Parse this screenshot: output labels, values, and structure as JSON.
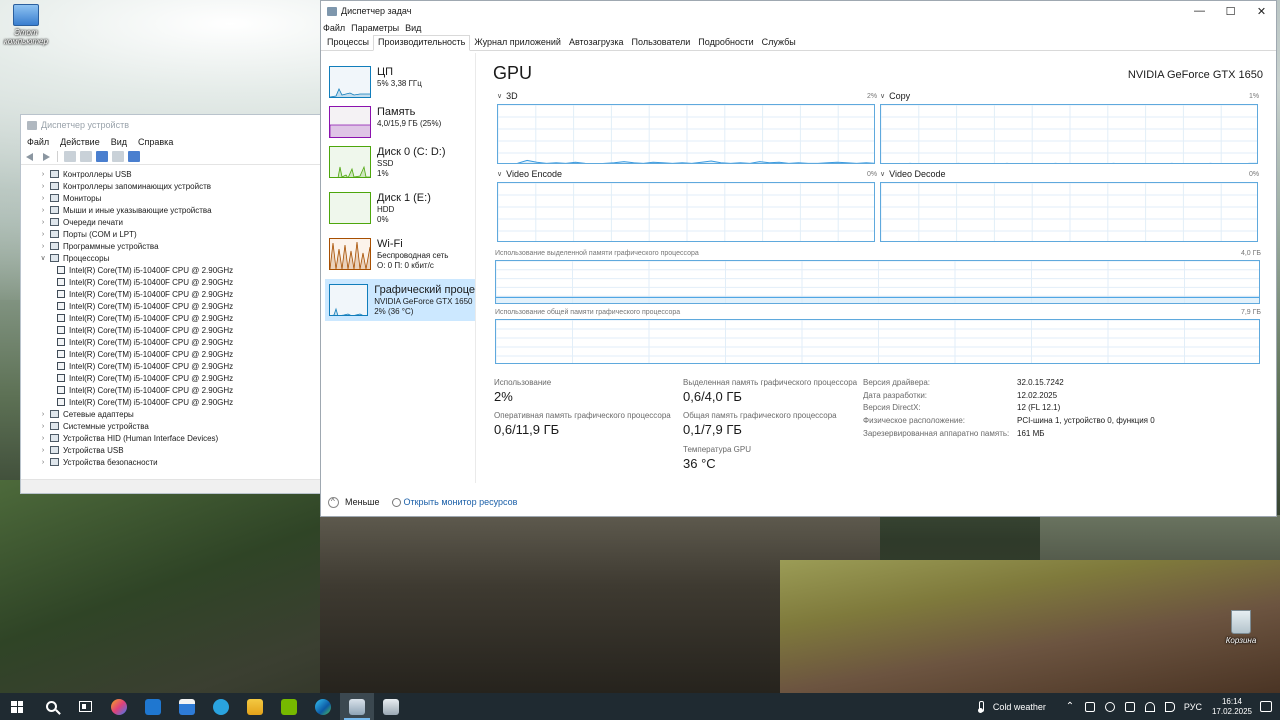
{
  "desktop": {
    "this_pc_label": "Этот компьютер",
    "recycle_bin_label": "Корзина"
  },
  "device_manager": {
    "title": "Диспетчер устройств",
    "menu": [
      "Файл",
      "Действие",
      "Вид",
      "Справка"
    ],
    "tree": [
      {
        "label": "Контроллеры USB",
        "expanded": false
      },
      {
        "label": "Контроллеры запоминающих устройств",
        "expanded": false
      },
      {
        "label": "Мониторы",
        "expanded": false
      },
      {
        "label": "Мыши и иные указывающие устройства",
        "expanded": false
      },
      {
        "label": "Очереди печати",
        "expanded": false
      },
      {
        "label": "Порты (COM и LPT)",
        "expanded": false
      },
      {
        "label": "Программные устройства",
        "expanded": false
      },
      {
        "label": "Процессоры",
        "expanded": true
      },
      {
        "label": "Сетевые адаптеры",
        "expanded": false
      },
      {
        "label": "Системные устройства",
        "expanded": false
      },
      {
        "label": "Устройства HID (Human Interface Devices)",
        "expanded": false
      },
      {
        "label": "Устройства USB",
        "expanded": false
      },
      {
        "label": "Устройства безопасности",
        "expanded": false
      }
    ],
    "processor_children": [
      "Intel(R) Core(TM) i5-10400F CPU @ 2.90GHz",
      "Intel(R) Core(TM) i5-10400F CPU @ 2.90GHz",
      "Intel(R) Core(TM) i5-10400F CPU @ 2.90GHz",
      "Intel(R) Core(TM) i5-10400F CPU @ 2.90GHz",
      "Intel(R) Core(TM) i5-10400F CPU @ 2.90GHz",
      "Intel(R) Core(TM) i5-10400F CPU @ 2.90GHz",
      "Intel(R) Core(TM) i5-10400F CPU @ 2.90GHz",
      "Intel(R) Core(TM) i5-10400F CPU @ 2.90GHz",
      "Intel(R) Core(TM) i5-10400F CPU @ 2.90GHz",
      "Intel(R) Core(TM) i5-10400F CPU @ 2.90GHz",
      "Intel(R) Core(TM) i5-10400F CPU @ 2.90GHz",
      "Intel(R) Core(TM) i5-10400F CPU @ 2.90GHz"
    ]
  },
  "task_manager": {
    "title": "Диспетчер задач",
    "menu": [
      "Файл",
      "Параметры",
      "Вид"
    ],
    "tabs": [
      "Процессы",
      "Производительность",
      "Журнал приложений",
      "Автозагрузка",
      "Пользователи",
      "Подробности",
      "Службы"
    ],
    "active_tab": "Производительность",
    "perf_items": [
      {
        "name": "ЦП",
        "line1": "5% 3,38 ГГц",
        "line2": "",
        "color": "#117dbb",
        "bg": "#f1f6fa"
      },
      {
        "name": "Память",
        "line1": "4,0/15,9 ГБ (25%)",
        "line2": "",
        "color": "#8b12ae",
        "bg": "#f4f2f4"
      },
      {
        "name": "Диск 0 (C: D:)",
        "line1": "SSD",
        "line2": "1%",
        "color": "#4da60c",
        "bg": "#eff7ec"
      },
      {
        "name": "Диск 1 (E:)",
        "line1": "HDD",
        "line2": "0%",
        "color": "#4da60c",
        "bg": "#eff7ec"
      },
      {
        "name": "Wi-Fi",
        "line1": "Беспроводная сеть",
        "line2": "О: 0 П: 0 кбит/с",
        "color": "#a74f01",
        "bg": "#fcf3eb"
      },
      {
        "name": "Графический проце",
        "line1": "NVIDIA GeForce GTX 1650",
        "line2": "2% (36 °C)",
        "color": "#117dbb",
        "bg": "#f1f6fa"
      }
    ],
    "selected_item": 5,
    "gpu": {
      "heading": "GPU",
      "model": "NVIDIA GeForce GTX 1650",
      "engines": [
        {
          "name": "3D",
          "pct": "2%",
          "series": [
            0,
            0,
            1,
            6,
            3,
            1,
            2,
            1,
            3,
            1,
            0,
            1,
            2,
            4,
            2,
            1,
            3,
            2,
            1,
            2,
            1,
            3,
            5,
            2,
            1,
            2,
            1,
            4,
            2,
            3,
            1,
            2,
            1,
            1,
            2,
            3,
            2,
            1,
            2,
            1
          ]
        },
        {
          "name": "Copy",
          "pct": "1%",
          "series": [
            0,
            0,
            0,
            1,
            0,
            0,
            0,
            0,
            1,
            0,
            0,
            0,
            0,
            1,
            0,
            0,
            0,
            0,
            1,
            0,
            0,
            0,
            0,
            0,
            1,
            0,
            0,
            0,
            0,
            0,
            1,
            0,
            0,
            0,
            1,
            0,
            0,
            0,
            1,
            1
          ]
        },
        {
          "name": "Video Encode",
          "pct": "0%",
          "series": []
        },
        {
          "name": "Video Decode",
          "pct": "0%",
          "series": []
        }
      ],
      "dedicated_label": "Использование выделенной памяти графического процессора",
      "dedicated_max": "4,0 ГБ",
      "dedicated_level": 0.15,
      "shared_label": "Использование общей памяти графического процессора",
      "shared_max": "7,9 ГБ",
      "shared_level": 0.01,
      "stats": {
        "usage_label": "Использование",
        "usage_value": "2%",
        "dedicated_mem_label": "Выделенная память графического процессора",
        "dedicated_mem_value": "0,6/4,0 ГБ",
        "gpu_ram_label": "Оперативная память графического процессора",
        "gpu_ram_value": "0,6/11,9 ГБ",
        "shared_mem_label": "Общая память графического процессора",
        "shared_mem_value": "0,1/7,9 ГБ",
        "temp_label": "Температура GPU",
        "temp_value": "36 °C"
      },
      "info": [
        {
          "k": "Версия драйвера:",
          "v": "32.0.15.7242"
        },
        {
          "k": "Дата разработки:",
          "v": "12.02.2025"
        },
        {
          "k": "Версия DirectX:",
          "v": "12 (FL 12.1)"
        },
        {
          "k": "Физическое расположение:",
          "v": "PCI-шина 1, устройство 0, функция 0"
        },
        {
          "k": "Зарезервированная аппаратно память:",
          "v": "161 МБ"
        }
      ]
    },
    "footer": {
      "less_label": "Меньше",
      "monitor_link": "Открыть монитор ресурсов"
    }
  },
  "taskbar": {
    "weather": "Cold weather",
    "language": "РУС",
    "time": "16:14",
    "date": "17.02.2025"
  }
}
